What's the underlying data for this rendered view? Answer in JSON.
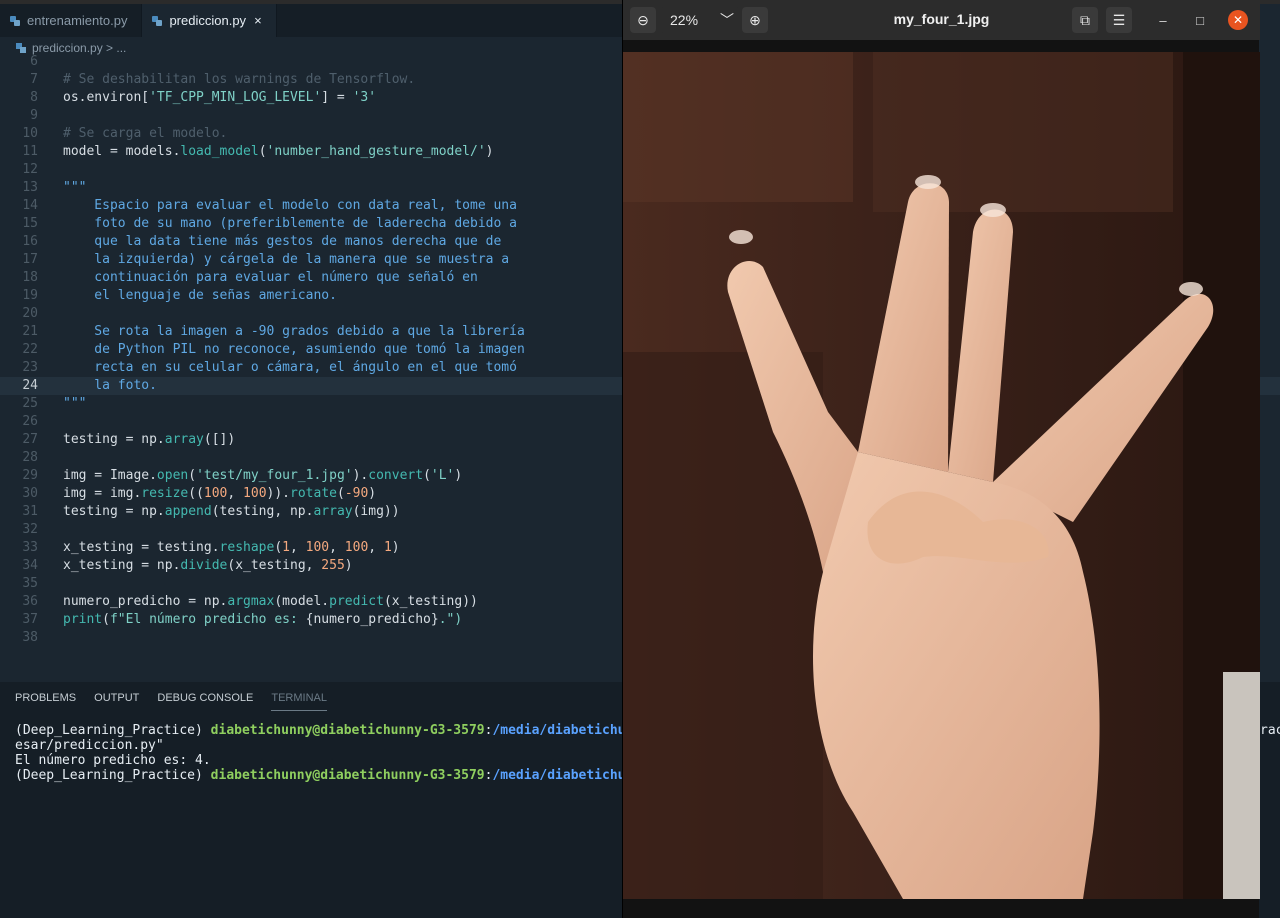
{
  "editor": {
    "tabs": [
      {
        "label": "entrenamiento.py",
        "active": false
      },
      {
        "label": "prediccion.py",
        "active": true
      }
    ],
    "tab_close": "×",
    "breadcrumb": "prediccion.py > ...",
    "lines": [
      {
        "n": "6",
        "segs": []
      },
      {
        "n": "7",
        "segs": [
          {
            "t": "# Se deshabilitan los warnings de Tensorflow.",
            "c": "comment"
          }
        ]
      },
      {
        "n": "8",
        "segs": [
          {
            "t": "os.environ[",
            "c": "plain"
          },
          {
            "t": "'TF_CPP_MIN_LOG_LEVEL'",
            "c": "str"
          },
          {
            "t": "] = ",
            "c": "plain"
          },
          {
            "t": "'3'",
            "c": "str"
          }
        ]
      },
      {
        "n": "9",
        "segs": []
      },
      {
        "n": "10",
        "segs": [
          {
            "t": "# Se carga el modelo.",
            "c": "comment"
          }
        ]
      },
      {
        "n": "11",
        "segs": [
          {
            "t": "model = models.",
            "c": "plain"
          },
          {
            "t": "load_model",
            "c": "fn"
          },
          {
            "t": "(",
            "c": "plain"
          },
          {
            "t": "'number_hand_gesture_model/'",
            "c": "str"
          },
          {
            "t": ")",
            "c": "plain"
          }
        ]
      },
      {
        "n": "12",
        "segs": []
      },
      {
        "n": "13",
        "segs": [
          {
            "t": "\"\"\"",
            "c": "doc"
          }
        ]
      },
      {
        "n": "14",
        "segs": [
          {
            "t": "    Espacio para evaluar el modelo con data real, tome una",
            "c": "doc"
          }
        ]
      },
      {
        "n": "15",
        "segs": [
          {
            "t": "    foto de su mano (preferiblemente de laderecha debido a",
            "c": "doc"
          }
        ]
      },
      {
        "n": "16",
        "segs": [
          {
            "t": "    que la data tiene más gestos de manos derecha que de",
            "c": "doc"
          }
        ]
      },
      {
        "n": "17",
        "segs": [
          {
            "t": "    la izquierda) y cárgela de la manera que se muestra a",
            "c": "doc"
          }
        ]
      },
      {
        "n": "18",
        "segs": [
          {
            "t": "    continuación para evaluar el número que señaló en",
            "c": "doc"
          }
        ]
      },
      {
        "n": "19",
        "segs": [
          {
            "t": "    el lenguaje de señas americano.",
            "c": "doc"
          }
        ]
      },
      {
        "n": "20",
        "segs": []
      },
      {
        "n": "21",
        "segs": [
          {
            "t": "    Se rota la imagen a -90 grados debido a que la librería",
            "c": "doc"
          }
        ]
      },
      {
        "n": "22",
        "segs": [
          {
            "t": "    de Python PIL no reconoce, asumiendo que tomó la imagen",
            "c": "doc"
          }
        ]
      },
      {
        "n": "23",
        "segs": [
          {
            "t": "    recta en su celular o cámara, el ángulo en el que tomó",
            "c": "doc"
          }
        ]
      },
      {
        "n": "24",
        "segs": [
          {
            "t": "    la foto.",
            "c": "doc"
          }
        ],
        "current": true
      },
      {
        "n": "25",
        "segs": [
          {
            "t": "\"\"\"",
            "c": "doc"
          }
        ]
      },
      {
        "n": "26",
        "segs": []
      },
      {
        "n": "27",
        "segs": [
          {
            "t": "testing = np.",
            "c": "plain"
          },
          {
            "t": "array",
            "c": "fn"
          },
          {
            "t": "([])",
            "c": "plain"
          }
        ]
      },
      {
        "n": "28",
        "segs": []
      },
      {
        "n": "29",
        "segs": [
          {
            "t": "img = Image.",
            "c": "plain"
          },
          {
            "t": "open",
            "c": "fn"
          },
          {
            "t": "(",
            "c": "plain"
          },
          {
            "t": "'test/my_four_1.jpg'",
            "c": "str"
          },
          {
            "t": ").",
            "c": "plain"
          },
          {
            "t": "convert",
            "c": "fn"
          },
          {
            "t": "(",
            "c": "plain"
          },
          {
            "t": "'L'",
            "c": "str"
          },
          {
            "t": ")",
            "c": "plain"
          }
        ]
      },
      {
        "n": "30",
        "segs": [
          {
            "t": "img = img.",
            "c": "plain"
          },
          {
            "t": "resize",
            "c": "fn"
          },
          {
            "t": "((",
            "c": "plain"
          },
          {
            "t": "100",
            "c": "num"
          },
          {
            "t": ", ",
            "c": "plain"
          },
          {
            "t": "100",
            "c": "num"
          },
          {
            "t": ")).",
            "c": "plain"
          },
          {
            "t": "rotate",
            "c": "fn"
          },
          {
            "t": "(",
            "c": "plain"
          },
          {
            "t": "-90",
            "c": "num"
          },
          {
            "t": ")",
            "c": "plain"
          }
        ]
      },
      {
        "n": "31",
        "segs": [
          {
            "t": "testing = np.",
            "c": "plain"
          },
          {
            "t": "append",
            "c": "fn"
          },
          {
            "t": "(testing, np.",
            "c": "plain"
          },
          {
            "t": "array",
            "c": "fn"
          },
          {
            "t": "(img))",
            "c": "plain"
          }
        ]
      },
      {
        "n": "32",
        "segs": []
      },
      {
        "n": "33",
        "segs": [
          {
            "t": "x_testing = testing.",
            "c": "plain"
          },
          {
            "t": "reshape",
            "c": "fn"
          },
          {
            "t": "(",
            "c": "plain"
          },
          {
            "t": "1",
            "c": "num"
          },
          {
            "t": ", ",
            "c": "plain"
          },
          {
            "t": "100",
            "c": "num"
          },
          {
            "t": ", ",
            "c": "plain"
          },
          {
            "t": "100",
            "c": "num"
          },
          {
            "t": ", ",
            "c": "plain"
          },
          {
            "t": "1",
            "c": "num"
          },
          {
            "t": ")",
            "c": "plain"
          }
        ]
      },
      {
        "n": "34",
        "segs": [
          {
            "t": "x_testing = np.",
            "c": "plain"
          },
          {
            "t": "divide",
            "c": "fn"
          },
          {
            "t": "(x_testing, ",
            "c": "plain"
          },
          {
            "t": "255",
            "c": "num"
          },
          {
            "t": ")",
            "c": "plain"
          }
        ]
      },
      {
        "n": "35",
        "segs": []
      },
      {
        "n": "36",
        "segs": [
          {
            "t": "numero_predicho = np.",
            "c": "plain"
          },
          {
            "t": "argmax",
            "c": "fn"
          },
          {
            "t": "(model.",
            "c": "plain"
          },
          {
            "t": "predict",
            "c": "fn"
          },
          {
            "t": "(x_testing))",
            "c": "plain"
          }
        ]
      },
      {
        "n": "37",
        "segs": [
          {
            "t": "print",
            "c": "fn"
          },
          {
            "t": "(",
            "c": "plain"
          },
          {
            "t": "f\"El número predicho es: ",
            "c": "str"
          },
          {
            "t": "{numero_predicho}",
            "c": "plain"
          },
          {
            "t": ".\")",
            "c": "str"
          }
        ]
      },
      {
        "n": "38",
        "segs": []
      }
    ]
  },
  "panel": {
    "tabs": [
      {
        "label": "PROBLEMS",
        "active": false
      },
      {
        "label": "OUTPUT",
        "active": false
      },
      {
        "label": "DEBUG CONSOLE",
        "active": false
      },
      {
        "label": "TERMINAL",
        "active": true
      }
    ],
    "terminal": {
      "env": "(Deep_Learning_Practice) ",
      "user": "diabetichunny@diabetichunny-G3-3579",
      "colon": ":",
      "path": "/media/diabetichunn",
      "line2": "esar/prediccion.py\"",
      "line3": "El número predicho es: 4.",
      "right_fragment": "ract"
    }
  },
  "viewer": {
    "title": "my_four_1.jpg",
    "zoom": "22%",
    "icons": {
      "zoom_out": "⊖",
      "zoom_dropdown": "﹀",
      "zoom_in": "⊕",
      "gallery": "⧉",
      "menu": "☰",
      "minimize": "–",
      "maximize": "□",
      "close": "✕"
    }
  },
  "colors": {
    "editor_bg": "#1b2630",
    "accent_close": "#e95420",
    "terminal_user": "#8fcf5f",
    "terminal_path": "#5aa2ff"
  }
}
